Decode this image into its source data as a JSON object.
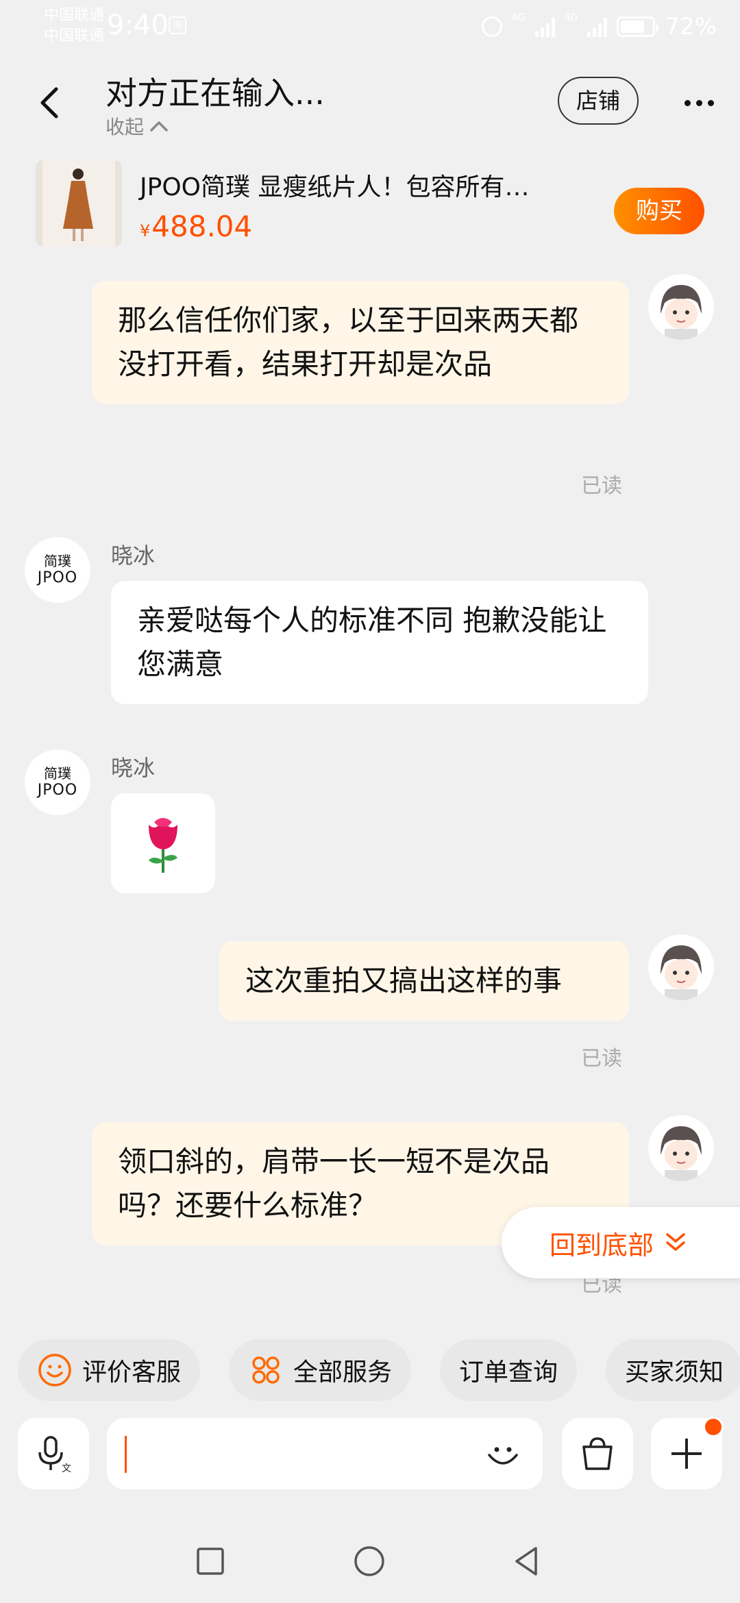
{
  "status_bar": {
    "carrier1": "中国联通",
    "carrier2": "中国联通",
    "time": "9:40",
    "app_badge": "淘",
    "network1": "4G",
    "network2": "4G",
    "battery": "72%"
  },
  "header": {
    "title": "对方正在输入...",
    "collapse_label": "收起",
    "store_label": "店铺"
  },
  "product": {
    "title": "JPOO简璞 显瘦纸片人！包容所有…",
    "currency": "¥",
    "price": "488.04",
    "buy_label": "购买"
  },
  "messages": [
    {
      "from": "me",
      "text": "那么信任你们家，以至于回来两天都没打开看，结果打开却是次品",
      "read": "已读"
    },
    {
      "from": "store",
      "sender": "晓冰",
      "text": "亲爱哒每个人的标准不同 抱歉没能让您满意"
    },
    {
      "from": "store",
      "sender": "晓冰",
      "text": "🌹"
    },
    {
      "from": "me",
      "text": "这次重拍又搞出这样的事",
      "read": "已读"
    },
    {
      "from": "me",
      "text": "领口斜的，肩带一长一短不是次品吗？还要什么标准？",
      "read": "已读"
    }
  ],
  "store_avatar": {
    "line1": "简璞",
    "line2": "JPOO"
  },
  "scroll_to_bottom": "回到底部",
  "quick_services": [
    "评价客服",
    "全部服务",
    "订单查询",
    "买家须知"
  ],
  "colors": {
    "accent": "#ff5000",
    "my_bubble": "#fff6e8",
    "background": "#f0f0f0"
  }
}
